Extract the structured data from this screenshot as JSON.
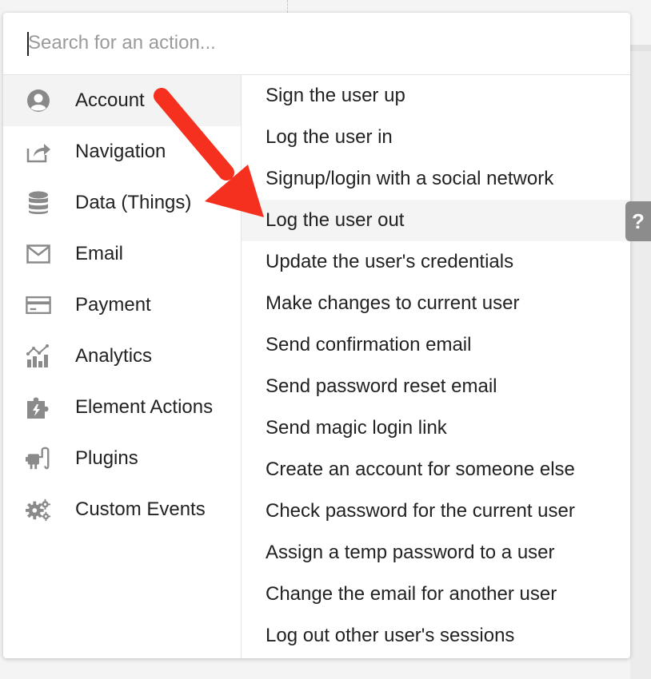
{
  "search": {
    "placeholder": "Search for an action..."
  },
  "categories": [
    {
      "label": "Account",
      "icon": "user-circle-icon",
      "active": true
    },
    {
      "label": "Navigation",
      "icon": "share-icon"
    },
    {
      "label": "Data (Things)",
      "icon": "database-icon"
    },
    {
      "label": "Email",
      "icon": "envelope-icon"
    },
    {
      "label": "Payment",
      "icon": "credit-card-icon"
    },
    {
      "label": "Analytics",
      "icon": "analytics-chart-icon"
    },
    {
      "label": "Element Actions",
      "icon": "puzzle-bolt-icon"
    },
    {
      "label": "Plugins",
      "icon": "plug-icon"
    },
    {
      "label": "Custom Events",
      "icon": "gears-icon"
    }
  ],
  "actions": [
    {
      "label": "Sign the user up"
    },
    {
      "label": "Log the user in"
    },
    {
      "label": "Signup/login with a social network"
    },
    {
      "label": "Log the user out",
      "highlighted": true
    },
    {
      "label": "Update the user's credentials"
    },
    {
      "label": "Make changes to current user"
    },
    {
      "label": "Send confirmation email"
    },
    {
      "label": "Send password reset email"
    },
    {
      "label": "Send magic login link"
    },
    {
      "label": "Create an account for someone else"
    },
    {
      "label": "Check password for the current user"
    },
    {
      "label": "Assign a temp password to a user"
    },
    {
      "label": "Change the email for another user"
    },
    {
      "label": "Log out other user's sessions"
    }
  ],
  "help": {
    "label": "?"
  },
  "colors": {
    "arrow": "#f5301e",
    "icon": "#8a8a8a",
    "help_tab": "#8c8c8c",
    "highlight": "#f4f4f4"
  }
}
